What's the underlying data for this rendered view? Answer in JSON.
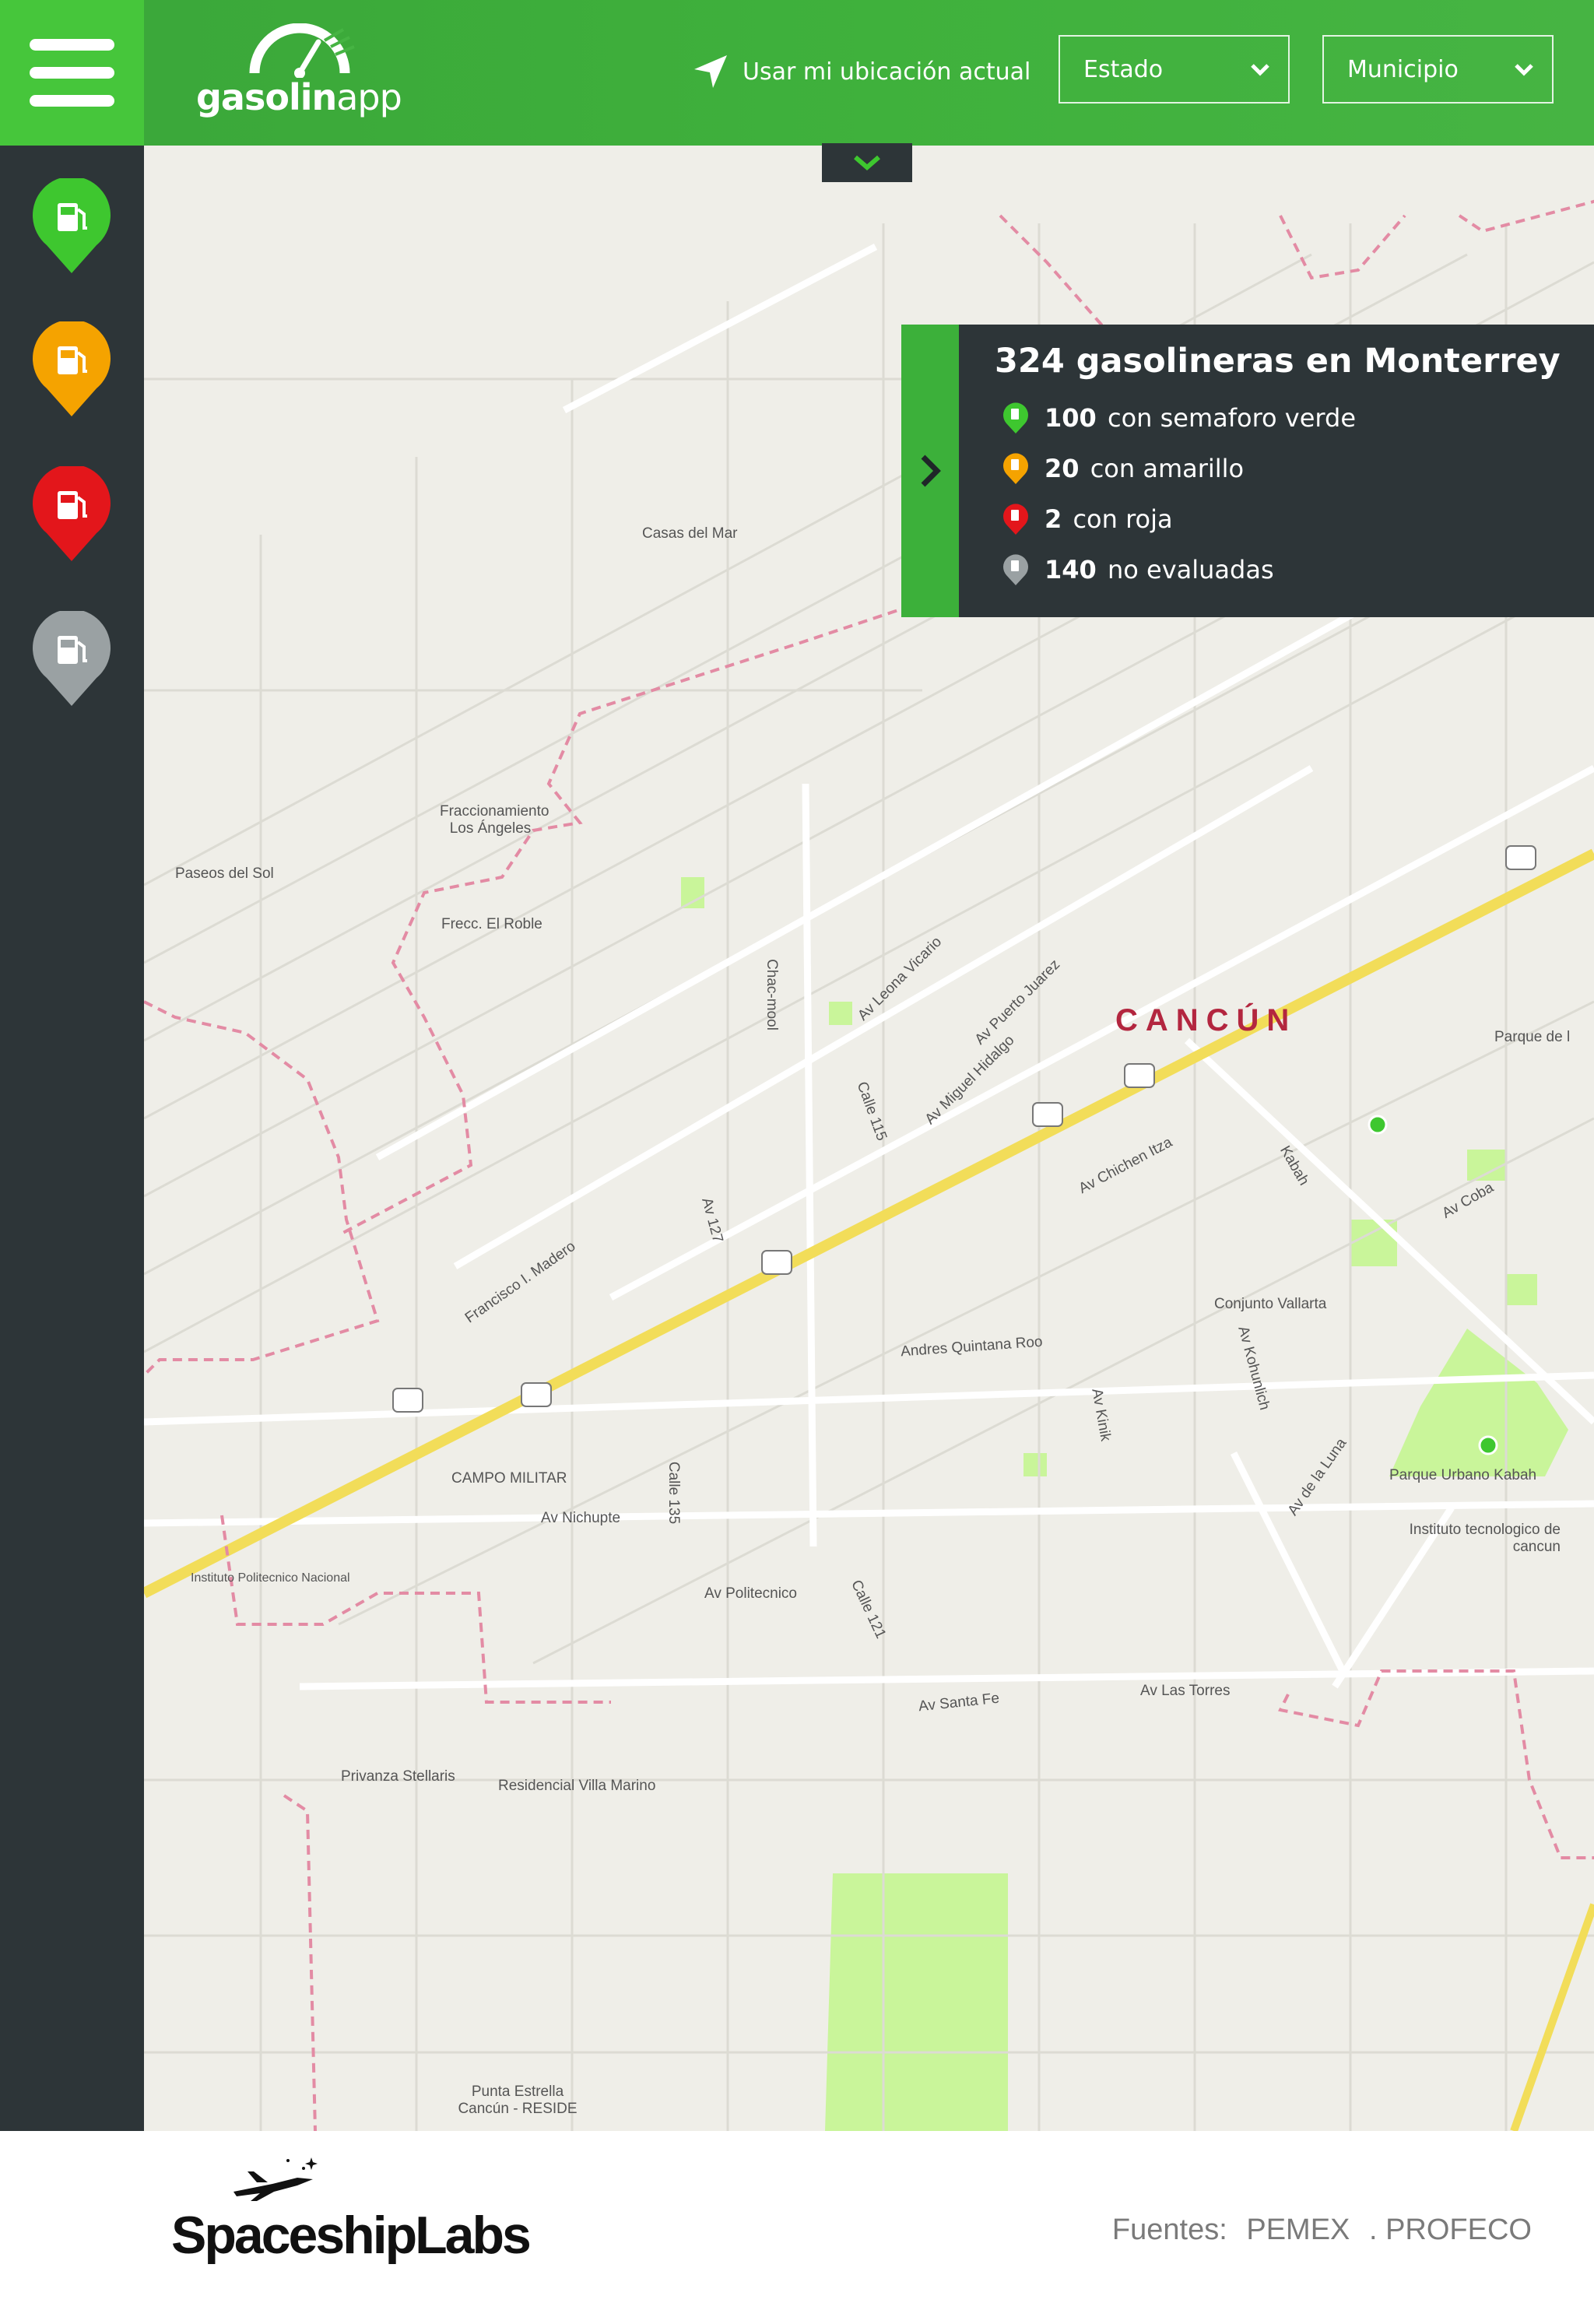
{
  "header": {
    "app_name_bold": "gasolin",
    "app_name_light": "app",
    "locate_label": "Usar mi ubicación actual",
    "state_select": "Estado",
    "municipality_select": "Municipio"
  },
  "sidebar": {
    "filters": [
      {
        "name": "verde",
        "color": "#3ec72f"
      },
      {
        "name": "amarillo",
        "color": "#f5a300"
      },
      {
        "name": "roja",
        "color": "#e3161b"
      },
      {
        "name": "no evaluadas",
        "color": "#9aa1a3"
      }
    ]
  },
  "stats": {
    "title": "324 gasolineras en Monterrey",
    "rows": [
      {
        "count": "100",
        "label": "con semaforo verde",
        "color": "#3ec72f"
      },
      {
        "count": "20",
        "label": "con amarillo",
        "color": "#f5a300"
      },
      {
        "count": "2",
        "label": "con roja",
        "color": "#e3161b"
      },
      {
        "count": "140",
        "label": "no evaluadas",
        "color": "#9aa1a3"
      }
    ]
  },
  "map": {
    "city": "CANCÚN",
    "labels": [
      "Casas del Mar",
      "Paseos del Sol",
      "Fraccionamiento Los Ángeles",
      "Frecc. El Roble",
      "Av Nichupte",
      "CAMPO MILITAR",
      "Andres Quintana Roo",
      "Conjunto Vallarta",
      "Parque Urbano Kabah",
      "Instituto tecnologico de cancun",
      "Av Politecnico",
      "Av Las Torres",
      "Privanza Stellaris",
      "Residencial Villa Marino",
      "Punta Estrella Cancún - RESIDE",
      "Av Chichen Itza",
      "Av Leona Vicario",
      "Av Miguel Hidalgo",
      "Av Puerto Juarez",
      "Av Coba",
      "Kabah",
      "Av Kohunlich",
      "Av de la Luna",
      "Av Kinik",
      "Calle 115",
      "Av 127",
      "Chac-mool",
      "Francisco I. Madero",
      "Instituto Politecnico Nacional",
      "Calle 135",
      "Calle 121",
      "Av Santa Fe",
      "Parque de l"
    ]
  },
  "footer": {
    "brand": "SpaceshipLabs",
    "sources_label": "Fuentes:",
    "sources": [
      "PEMEX",
      ". PROFECO"
    ]
  }
}
